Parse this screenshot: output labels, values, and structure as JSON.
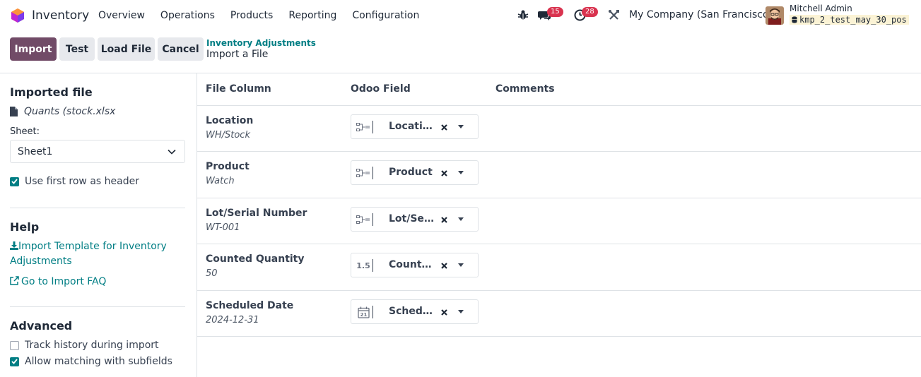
{
  "navbar": {
    "app_name": "Inventory",
    "menu": [
      "Overview",
      "Operations",
      "Products",
      "Reporting",
      "Configuration"
    ],
    "messages_badge": "15",
    "activities_badge": "28",
    "company": "My Company (San Francisco)",
    "user_name": "Mitchell Admin",
    "db_name": "kmp_2_test_may_30_pos"
  },
  "controls": {
    "import_label": "Import",
    "test_label": "Test",
    "load_file_label": "Load File",
    "cancel_label": "Cancel"
  },
  "breadcrumb": {
    "parent": "Inventory Adjustments",
    "current": "Import a File"
  },
  "sidebar": {
    "imported_file_title": "Imported file",
    "file_name": "Quants (stock.xlsx",
    "sheet_label": "Sheet:",
    "sheet_value": "Sheet1",
    "first_row_header_label": "Use first row as header",
    "first_row_header_checked": true,
    "help_title": "Help",
    "template_link": "Import Template for Inventory Adjustments",
    "faq_link": "Go to Import FAQ",
    "advanced_title": "Advanced",
    "track_history_label": "Track history during import",
    "track_history_checked": false,
    "allow_matching_label": "Allow matching with subfields",
    "allow_matching_checked": true
  },
  "table": {
    "headers": {
      "file_column": "File Column",
      "odoo_field": "Odoo Field",
      "comments": "Comments"
    },
    "rows": [
      {
        "column": "Location",
        "sample": "WH/Stock",
        "field": "Location",
        "field_icon": "relation-icon"
      },
      {
        "column": "Product",
        "sample": "Watch",
        "field": "Product",
        "field_icon": "relation-icon"
      },
      {
        "column": "Lot/Serial Number",
        "sample": "WT-001",
        "field": "Lot/Serial Number",
        "field_icon": "relation-icon"
      },
      {
        "column": "Counted Quantity",
        "sample": "50",
        "field": "Counted Quantity",
        "field_icon": "float-icon",
        "field_icon_text": "1.5"
      },
      {
        "column": "Scheduled Date",
        "sample": "2024-12-31",
        "field": "Scheduled Date",
        "field_icon": "calendar-icon"
      }
    ]
  },
  "colors": {
    "primary": "#714b67",
    "link": "#017e84",
    "badge": "#d9334f"
  }
}
